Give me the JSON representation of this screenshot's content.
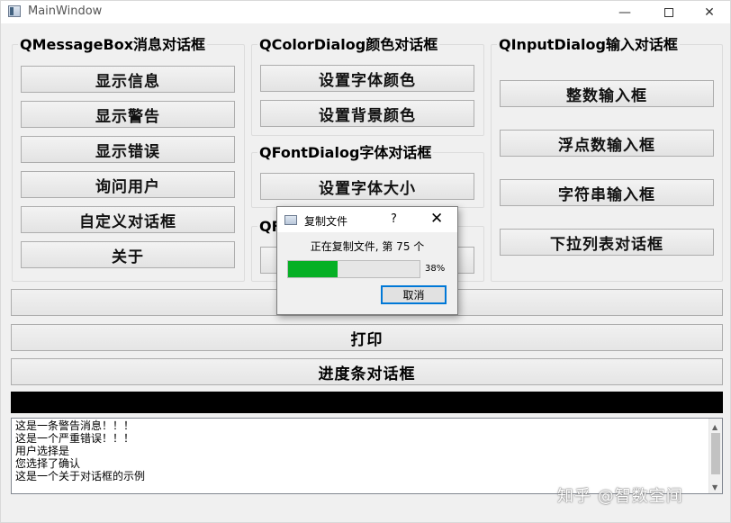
{
  "window": {
    "title": "MainWindow",
    "min_glyph": "—",
    "close_glyph": "✕"
  },
  "groups": {
    "message": {
      "title": "QMessageBox消息对话框",
      "buttons": [
        "显示信息",
        "显示警告",
        "显示错误",
        "询问用户",
        "自定义对话框",
        "关于"
      ]
    },
    "color": {
      "title": "QColorDialog颜色对话框",
      "buttons": [
        "设置字体颜色",
        "设置背景颜色"
      ]
    },
    "font": {
      "title": "QFontDialog字体对话框",
      "buttons": [
        "设置字体大小"
      ]
    },
    "file": {
      "title": "QFi"
    },
    "input": {
      "title": "QInputDialog输入对话框",
      "buttons": [
        "整数输入框",
        "浮点数输入框",
        "字符串输入框",
        "下拉列表对话框"
      ]
    }
  },
  "wide_buttons": {
    "blank": "",
    "print": "打印",
    "progress": "进度条对话框"
  },
  "log": {
    "lines": [
      "这是一条警告消息！！！",
      "这是一个严重错误！！！",
      "用户选择是",
      "您选择了确认",
      "这是一个关于对话框的示例"
    ],
    "scroll_up": "▲",
    "scroll_down": "▼"
  },
  "watermark": "知乎 @智数空间",
  "progress_dialog": {
    "title": "复制文件",
    "help": "?",
    "close": "✕",
    "message": "正在复制文件, 第  75  个",
    "progress": 0.38,
    "percent_label": "38%",
    "cancel_label": "取消",
    "fill_color": "#06b025"
  }
}
